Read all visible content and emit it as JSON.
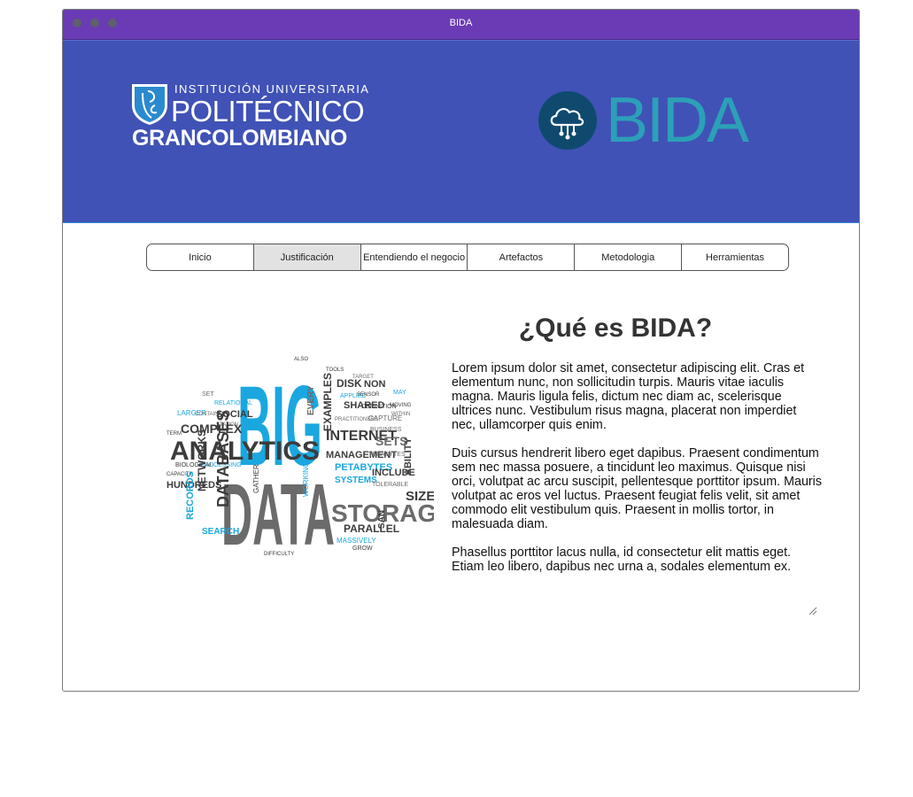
{
  "window": {
    "title": "BIDA"
  },
  "header": {
    "institution_logo": {
      "line1": "INSTITUCIÓN UNIVERSITARIA",
      "line2": "POLITÉCNICO",
      "line3": "GRANCOLOMBIANO",
      "shield_monogram": "PG"
    },
    "bida_logo": {
      "word": "BIDA",
      "icon": "cloud-network-icon"
    }
  },
  "nav": {
    "tabs": [
      {
        "label": "Inicio",
        "active": false
      },
      {
        "label": "Justificación",
        "active": true
      },
      {
        "label": "Entendiendo el negocio",
        "active": false
      },
      {
        "label": "Artefactos",
        "active": false
      },
      {
        "label": "Metodologia",
        "active": false
      },
      {
        "label": "Herramientas",
        "active": false
      }
    ]
  },
  "main": {
    "title": "¿Qué es BIDA?",
    "paragraphs": [
      "Lorem ipsum dolor sit amet, consectetur adipiscing elit. Cras et elementum nunc, non sollicitudin turpis. Mauris vitae iaculis magna. Mauris ligula felis, dictum nec diam ac, scelerisque ultrices nunc. Vestibulum risus magna, placerat non imperdiet nec, ullamcorper quis enim.",
      "Duis cursus hendrerit libero eget dapibus. Praesent condimentum sem nec massa posuere, a tincidunt leo maximus. Quisque nisi orci, volutpat ac arcu suscipit, pellentesque porttitor ipsum. Mauris volutpat ac eros vel luctus. Praesent feugiat felis velit, sit amet commodo elit vestibulum quis. Praesent in mollis tortor, in malesuada diam.",
      "Phasellus porttitor lacus nulla, id consectetur elit mattis eget. Etiam leo libero, dapibus nec urna a, sodales elementum ex."
    ],
    "word_cloud": {
      "big": "BIG",
      "data": "DATA",
      "words": [
        "ALSO",
        "TOOLS",
        "TARGET",
        "DISK",
        "NON",
        "APPLIED",
        "SENSOR",
        "MAY",
        "SET",
        "RELATIONAL",
        "SHARED",
        "DEFINITION",
        "MOVING",
        "LARGER",
        "CONTAINER",
        "SOCIAL",
        "PRACTITIONERS",
        "CAPTURE",
        "WITHIN",
        "COMPLEX",
        "STATION",
        "BUSINESS",
        "TERM",
        "INTERNET",
        "SETS",
        "ANALYTICS",
        "EVERY",
        "EXAMPLES",
        "BIOLOGICAL",
        "PROCESSING",
        "MANAGEMENT",
        "TERABYTES",
        "CAPACITY",
        "PETABYTES",
        "INCLUDE",
        "ABILITY",
        "HUNDREDS",
        "NETWORKS",
        "DATABASES",
        "SYSTEMS",
        "TOLERABLE",
        "SIZE",
        "RECORDS",
        "GATHER",
        "WORKING",
        "STORAGE",
        "SEARCH",
        "PARALLEL",
        "SAN",
        "MASSIVELY",
        "GROW",
        "DIFFICULTY"
      ],
      "colors": {
        "blue": "#1aa7e0",
        "gray": "#6b6b6b",
        "dark": "#3c3c3c"
      }
    }
  },
  "colors": {
    "titlebar": "#6a3bb4",
    "header": "#4052b6",
    "bida_accent": "#2ca0b8",
    "bida_circle": "#0f4a6e",
    "active_tab": "#e2e2e2"
  }
}
